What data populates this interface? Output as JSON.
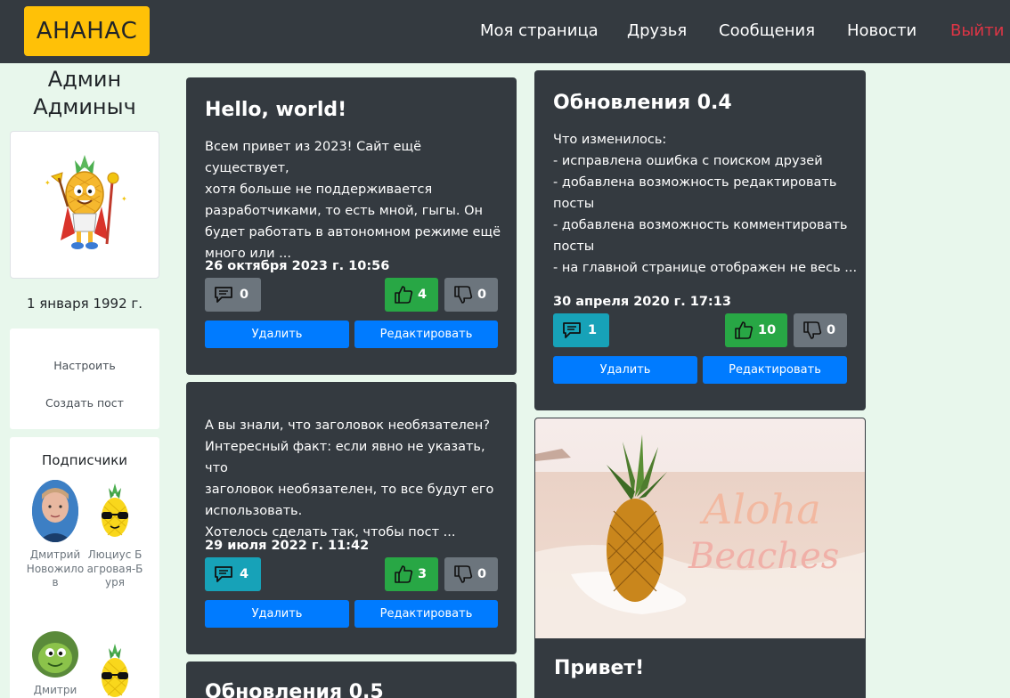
{
  "navbar": {
    "brand": "АНАНАС",
    "links": [
      "Моя страница",
      "Друзья",
      "Сообщения",
      "Новости"
    ],
    "logout": "Выйти"
  },
  "profile": {
    "name": "Админ Админыч",
    "birthdate": "1 января 1992 г.",
    "menu": [
      "Настроить",
      "Создать пост"
    ]
  },
  "subscribers": {
    "title": "Подписчики",
    "items": [
      {
        "name": "Дмитрий Новожилов"
      },
      {
        "name": "Люциус Багровая-Буря"
      },
      {
        "name": "Дмитри"
      }
    ]
  },
  "posts": [
    {
      "title": "Hello, world!",
      "text": "Всем привет из 2023! Сайт ещё существует,\nхотя больше не поддерживается\nразработчиками, то есть мной, гыгы. Он\nбудет работать в автономном режиме ещё\nмного или ...",
      "date": "26 октября 2023 г. 10:56",
      "comments": "0",
      "likes": "4",
      "dislikes": "0",
      "delete_label": "Удалить",
      "edit_label": "Редактировать"
    },
    {
      "title": "",
      "text": "А вы знали, что заголовок необязателен?\nИнтересный факт: если явно не указать, что\nзаголовок необязателен, то все будут его\nиспользовать.\nХотелось сделать так, чтобы пост ...",
      "date": "29 июля 2022 г. 11:42",
      "comments": "4",
      "likes": "3",
      "dislikes": "0",
      "delete_label": "Удалить",
      "edit_label": "Редактировать"
    },
    {
      "title": "Обновления 0.5"
    },
    {
      "title": "Обновления 0.4",
      "text": "Что изменилось:\n- исправлена ошибка с поиском друзей\n- добавлена возможность редактировать\nпосты\n- добавлена возможность комментировать\nпосты\n- на главной странице отображен не весь ...",
      "date": "30 апреля 2020 г. 17:13",
      "comments": "1",
      "likes": "10",
      "dislikes": "0",
      "delete_label": "Удалить",
      "edit_label": "Редактировать"
    },
    {
      "title": "Привет!",
      "image_text": [
        "Aloha",
        "Beaches"
      ]
    }
  ],
  "colors": {
    "navbar": "#343a40",
    "brand": "#ffc107",
    "logout": "#dc3545",
    "card": "#343a40",
    "primary": "#007bff",
    "like": "#28a745",
    "comment_active": "#17a2b8",
    "neutral": "#6c757d",
    "page_bg": "#e8f7ec"
  },
  "icons": {
    "comment": "speech-bubble-icon",
    "like": "thumbs-up-icon",
    "dislike": "thumbs-down-icon"
  }
}
